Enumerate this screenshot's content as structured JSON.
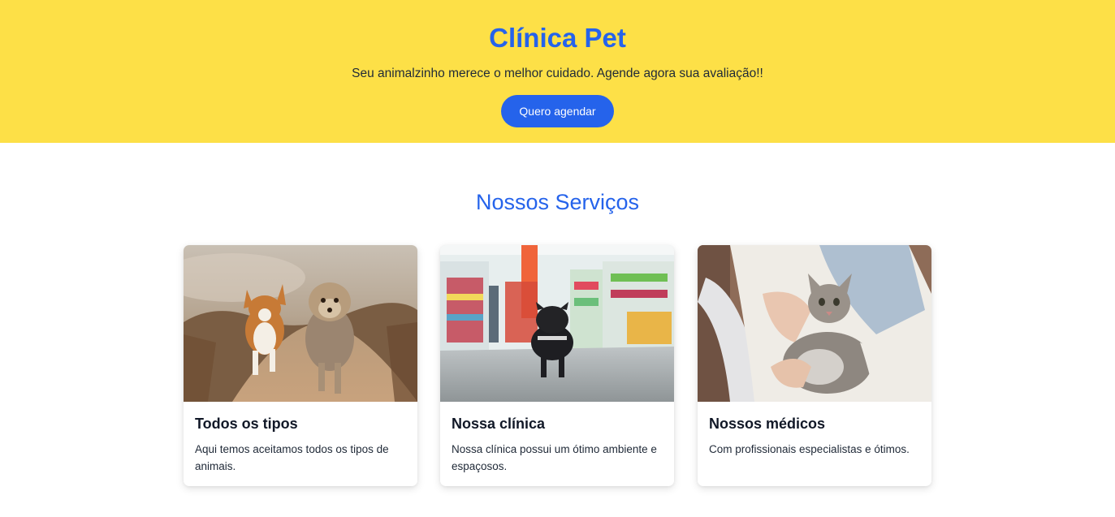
{
  "hero": {
    "title": "Clínica Pet",
    "subtitle": "Seu animalzinho merece o melhor cuidado. Agende agora sua avaliação!!",
    "cta_label": "Quero agendar"
  },
  "services": {
    "title": "Nossos Serviços",
    "cards": [
      {
        "title": "Todos os tipos",
        "text": "Aqui temos aceitamos todos os tipos de animais.",
        "image": "corgi-and-yorkshire-running-photo"
      },
      {
        "title": "Nossa clínica",
        "text": "Nossa clínica possui um ótimo ambiente e espaçosos.",
        "image": "french-bulldog-in-pet-store-photo"
      },
      {
        "title": "Nossos médicos",
        "text": "Com profissionais especialistas e ótimos.",
        "image": "tabby-cat-held-by-person-photo"
      }
    ]
  },
  "colors": {
    "hero_bg": "#fde047",
    "accent": "#2563eb",
    "text": "#1f2937"
  }
}
